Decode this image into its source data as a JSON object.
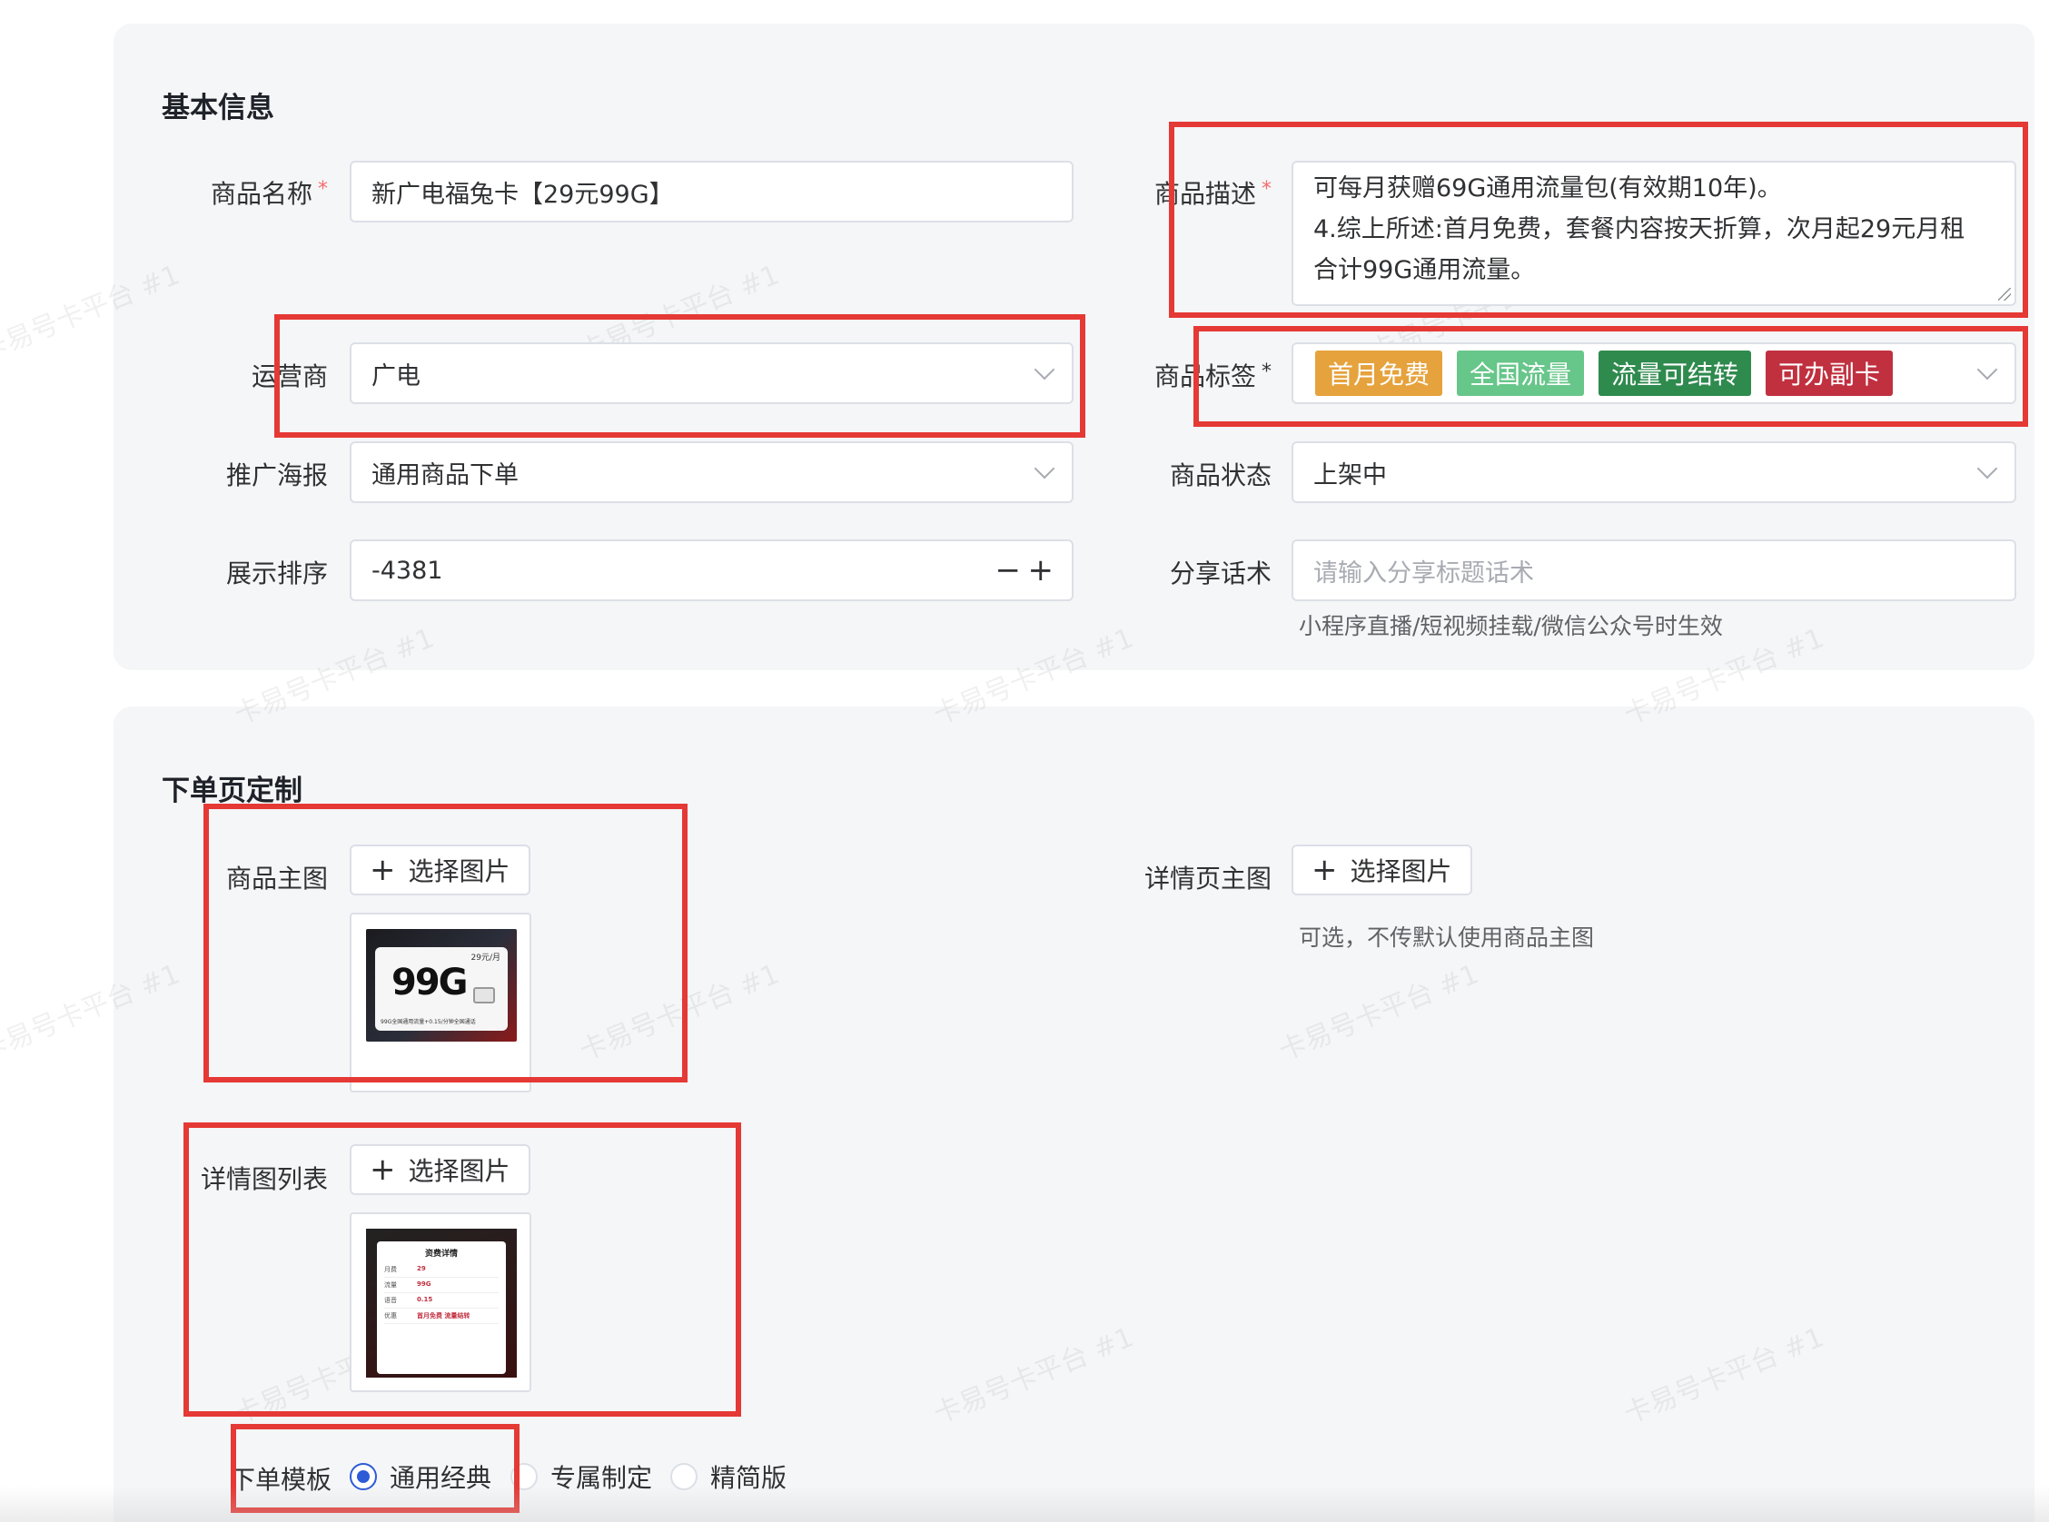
{
  "watermark": "卡易号卡平台 #1",
  "basic": {
    "title": "基本信息",
    "name_label": "商品名称",
    "name_value": "新广电福兔卡【29元99G】",
    "desc_label": "商品描述",
    "desc_lines": [
      "可每月获赠69G通用流量包(有效期10年)。",
      "4.综上所述:首月免费，套餐内容按天折算，次月起29元月租",
      "合计99G通用流量。"
    ],
    "operator_label": "运营商",
    "operator_value": "广电",
    "tags_label": "商品标签",
    "tags": [
      {
        "label": "首月免费",
        "color": "#e6a23c"
      },
      {
        "label": "全国流量",
        "color": "#67c68a"
      },
      {
        "label": "流量可结转",
        "color": "#2f8a4e"
      },
      {
        "label": "可办副卡",
        "color": "#c0303f"
      }
    ],
    "poster_label": "推广海报",
    "poster_value": "通用商品下单",
    "status_label": "商品状态",
    "status_value": "上架中",
    "sort_label": "展示排序",
    "sort_value": "-4381",
    "share_label": "分享话术",
    "share_placeholder": "请输入分享标题话术",
    "share_hint": "小程序直播/短视频挂载/微信公众号时生效",
    "required_mark": "*"
  },
  "order_page": {
    "title": "下单页定制",
    "main_image_label": "商品主图",
    "detail_main_label": "详情页主图",
    "detail_main_hint": "可选，不传默认使用商品主图",
    "detail_list_label": "详情图列表",
    "select_image": "选择图片",
    "plus_icon": "+",
    "template_label": "下单模板",
    "template_options": [
      "通用经典",
      "专属制定",
      "精简版"
    ],
    "template_selected": "通用经典"
  },
  "thumb_main": {
    "headline": "99G",
    "price": "29元/月",
    "footer": "99G全国通用流量+0.15/分钟全国通话"
  },
  "thumb_detail": {
    "title": "资费详情",
    "rows": [
      {
        "k": "月费",
        "v": "29"
      },
      {
        "k": "流量",
        "v": "99G"
      },
      {
        "k": "语音",
        "v": "0.15"
      },
      {
        "k": "优惠",
        "v": "首月免费 流量结转"
      }
    ]
  },
  "colors": {
    "required": "#f56c6c",
    "highlight_box": "#e53935",
    "radio_accent": "#2d5bd6"
  }
}
